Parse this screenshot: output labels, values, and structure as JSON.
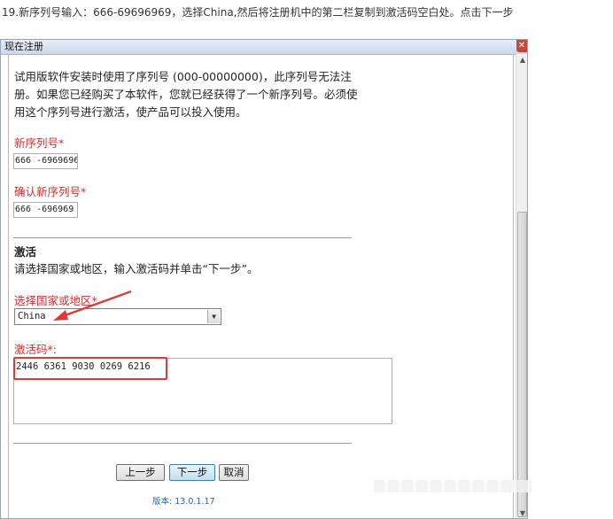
{
  "instruction": "19.新序列号输入：666-69696969，选择China,然后将注册机中的第二栏复制到激活码空白处。点击下一步",
  "window": {
    "title": "现在注册",
    "close_icon": "close-icon"
  },
  "intro_text": "试用版软件安装时使用了序列号 (000-00000000)，此序列号无法注册。如果您已经购买了本软件，您就已经获得了一个新序列号。必须使用这个序列号进行激活，使产品可以投入使用。",
  "serial": {
    "label": "新序列号*",
    "value": "666 -6969696"
  },
  "confirm_serial": {
    "label": "确认新序列号*",
    "value": "666 -696969"
  },
  "activation": {
    "heading": "激活",
    "description": "请选择国家或地区，输入激活码并单击“下一步”。",
    "country_label": "选择国家或地区*",
    "country_value": "China",
    "code_label": "激活码*:",
    "code_value": "2446 6361 9030 0269 6216"
  },
  "buttons": {
    "back": "上一步",
    "next": "下一步",
    "cancel": "取消"
  },
  "version": "版本: 13.0.1.17",
  "colors": {
    "required_red": "#d2302b",
    "highlight_red": "#e03a36",
    "link_blue": "#2b63b8"
  }
}
